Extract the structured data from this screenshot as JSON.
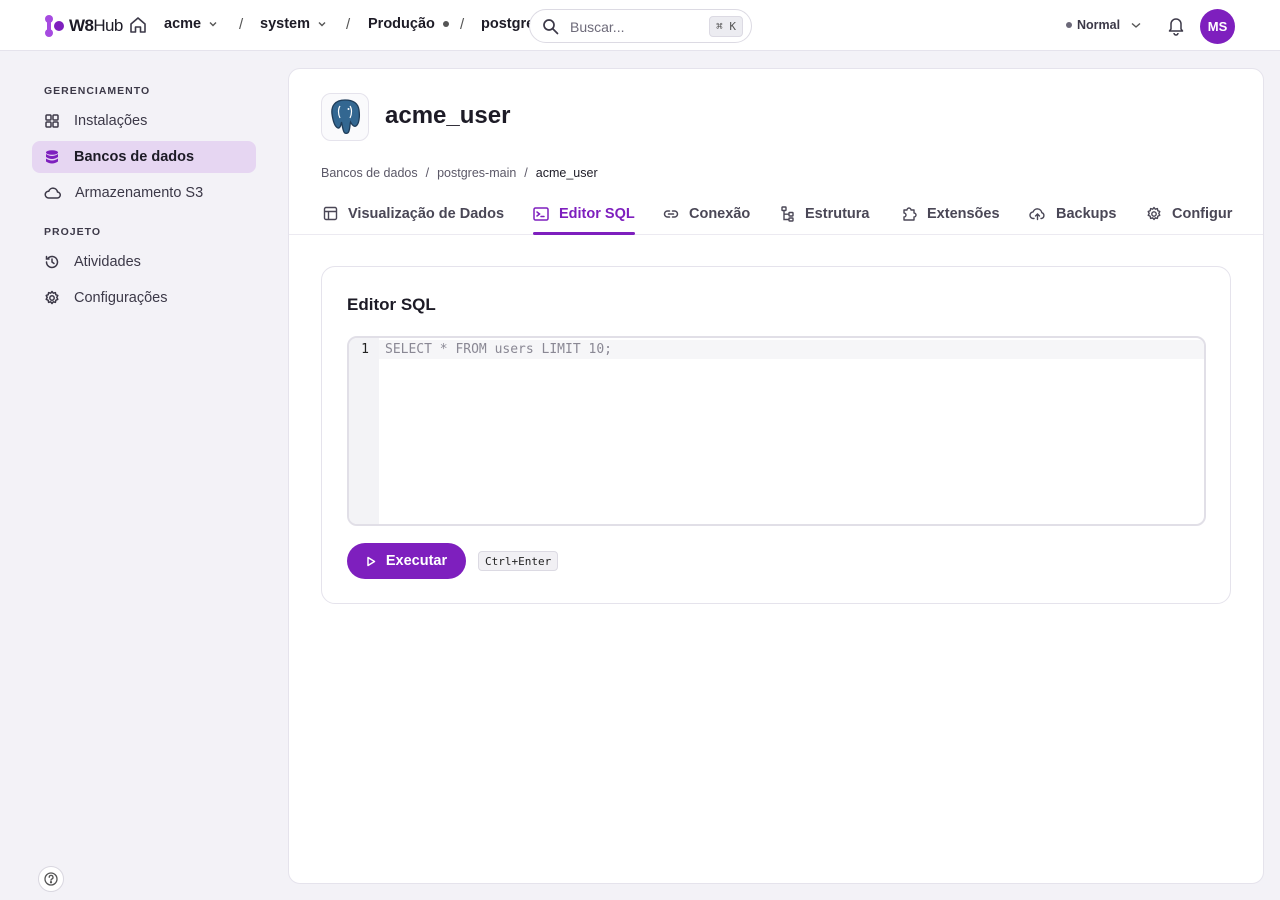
{
  "brand": {
    "name_part1": "W8",
    "name_part2": "Hub"
  },
  "topbar": {
    "org": "acme",
    "project": "system",
    "environment": "Produção",
    "resource_truncated": "postgres",
    "search_placeholder": "Buscar...",
    "search_shortcut": "⌘ K",
    "mode": "Normal",
    "avatar_initials": "MS"
  },
  "sidebar": {
    "section_manage": "GERENCIAMENTO",
    "section_project": "PROJETO",
    "items": [
      {
        "label": "Instalações",
        "icon": "grid-icon"
      },
      {
        "label": "Bancos de dados",
        "icon": "database-icon",
        "active": true
      },
      {
        "label": "Armazenamento S3",
        "icon": "cloud-icon"
      },
      {
        "label": "Atividades",
        "icon": "history-icon"
      },
      {
        "label": "Configurações",
        "icon": "gear-icon"
      }
    ]
  },
  "page": {
    "title": "acme_user",
    "breadcrumb": [
      "Bancos de dados",
      "postgres-main",
      "acme_user"
    ],
    "tabs": [
      {
        "label": "Visualização de Dados",
        "icon": "table-icon"
      },
      {
        "label": "Editor SQL",
        "icon": "terminal-icon",
        "active": true
      },
      {
        "label": "Conexão",
        "icon": "link-icon"
      },
      {
        "label": "Estrutura",
        "icon": "tree-icon"
      },
      {
        "label": "Extensões",
        "icon": "puzzle-icon"
      },
      {
        "label": "Backups",
        "icon": "cloud-upload-icon"
      },
      {
        "label": "Configur",
        "icon": "gear-icon"
      }
    ]
  },
  "editor": {
    "heading": "Editor SQL",
    "line_number": "1",
    "placeholder_query": "SELECT * FROM users LIMIT 10;",
    "run_label": "Executar",
    "run_shortcut": "Ctrl+Enter"
  },
  "colors": {
    "accent": "#7e1fbe",
    "active_nav_bg": "#e6d6f2"
  }
}
